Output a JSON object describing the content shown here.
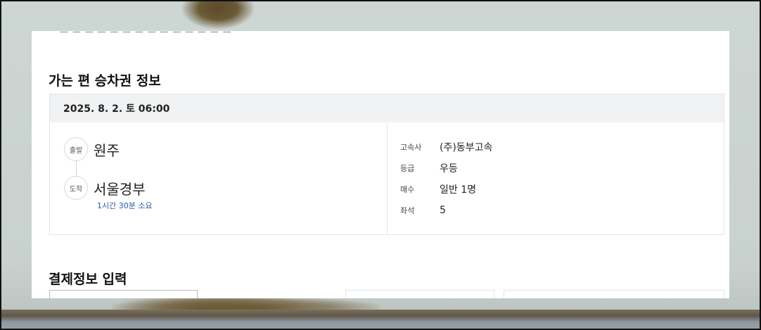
{
  "outbound": {
    "section_title": "가는 편 승차권 정보",
    "date_time": "2025. 8. 2. 토 06:00",
    "departure": {
      "badge": "출발",
      "name": "원주"
    },
    "arrival": {
      "badge": "도착",
      "name": "서울경부"
    },
    "duration": "1시간 30분 소요",
    "details": [
      {
        "key": "고속사",
        "value": "(주)동부고속"
      },
      {
        "key": "등급",
        "value": "우등"
      },
      {
        "key": "매수",
        "value": "일반 1명"
      },
      {
        "key": "좌석",
        "value": "5"
      }
    ]
  },
  "payment": {
    "section_title": "결제정보 입력"
  }
}
